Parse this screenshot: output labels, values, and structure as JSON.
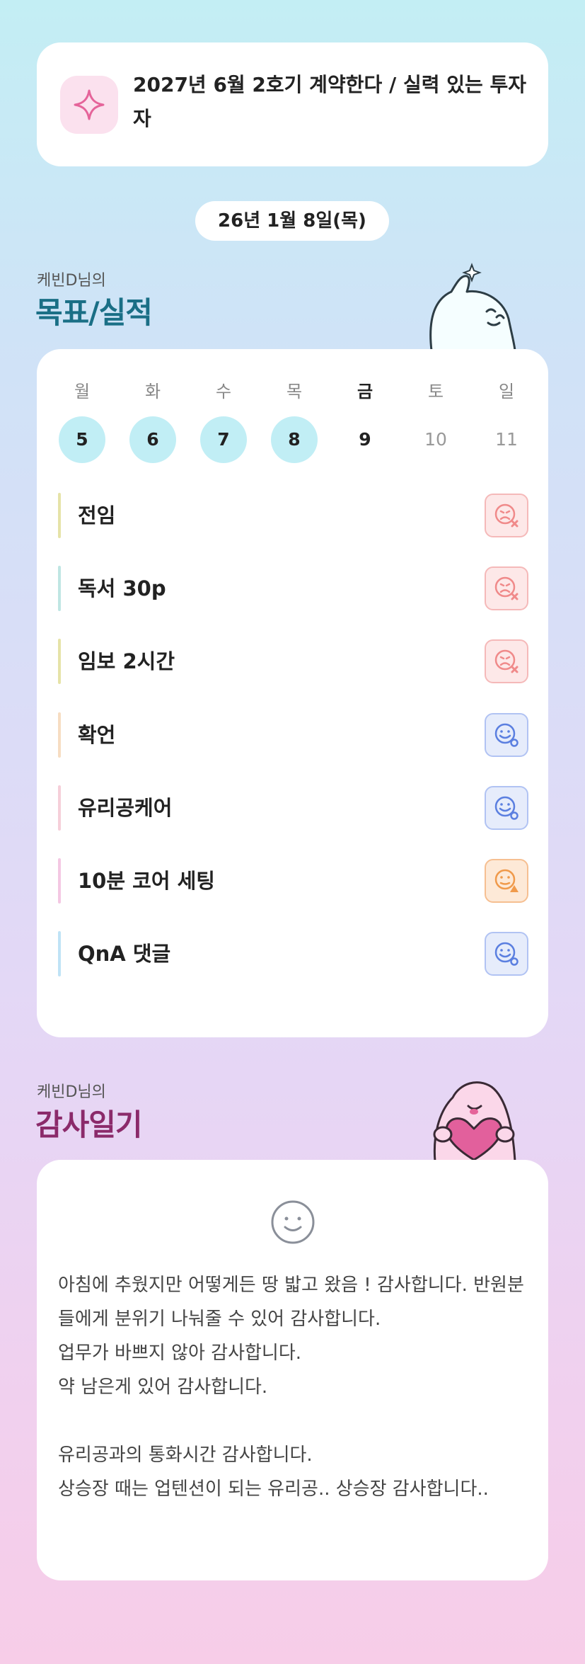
{
  "goal_banner": {
    "icon": "sparkle-icon",
    "text": "2027년 6월 2호기 계약한다 / 실력 있는 투자자"
  },
  "date": "26년 1월 8일(목)",
  "goals_section": {
    "subtitle": "케빈D님의",
    "title": "목표/실적"
  },
  "week": {
    "days": [
      {
        "label": "월",
        "date": "5",
        "state": "done"
      },
      {
        "label": "화",
        "date": "6",
        "state": "done"
      },
      {
        "label": "수",
        "date": "7",
        "state": "done"
      },
      {
        "label": "목",
        "date": "8",
        "state": "done"
      },
      {
        "label": "금",
        "date": "9",
        "state": "today"
      },
      {
        "label": "토",
        "date": "10",
        "state": "future"
      },
      {
        "label": "일",
        "date": "11",
        "state": "future"
      }
    ]
  },
  "tasks": [
    {
      "label": "전임",
      "status": "fail",
      "bar_color": "#e6e3a8",
      "icon": "sad-face-x-icon"
    },
    {
      "label": "독서 30p",
      "status": "fail",
      "bar_color": "#bfe6e3",
      "icon": "sad-face-x-icon"
    },
    {
      "label": "임보 2시간",
      "status": "fail",
      "bar_color": "#e6e3a8",
      "icon": "sad-face-x-icon"
    },
    {
      "label": "확언",
      "status": "success",
      "bar_color": "#f7ddc2",
      "icon": "smile-face-o-icon"
    },
    {
      "label": "유리공케어",
      "status": "success",
      "bar_color": "#f6cfd9",
      "icon": "smile-face-o-icon"
    },
    {
      "label": "10분 코어 세팅",
      "status": "partial",
      "bar_color": "#f4c8e3",
      "icon": "neutral-face-triangle-icon"
    },
    {
      "label": "QnA 댓글",
      "status": "success",
      "bar_color": "#bfe3f6",
      "icon": "smile-face-o-icon"
    }
  ],
  "gratitude_section": {
    "subtitle": "케빈D님의",
    "title": "감사일기"
  },
  "diary": {
    "mood_icon": "smile-icon",
    "text": "아침에 추웠지만 어떻게든 땅 밟고 왔음 ! 감사합니다. 반원분들에게 분위기 나눠줄 수 있어 감사합니다.\n업무가 바쁘지 않아 감사합니다.\n약 남은게 있어 감사합니다.\n\n유리공과의 통화시간 감사합니다.\n상승장 때는 업텐션이 되는 유리공.. 상승장 감사합니다.."
  },
  "colors": {
    "goals_title": "#1a6f86",
    "gratitude_title": "#8b2a6a",
    "done_circle": "#c1eef5",
    "fail": "#f08a8a",
    "success": "#5b7fe0",
    "partial": "#f09a4b"
  }
}
